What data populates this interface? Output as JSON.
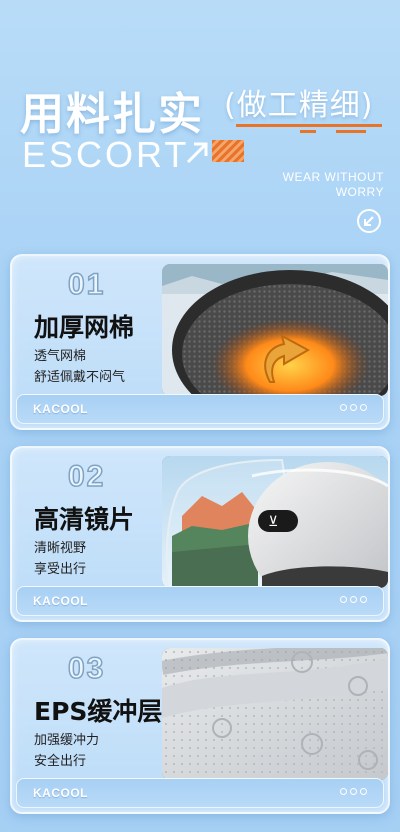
{
  "header": {
    "title_main": "用料扎实",
    "title_sub": "(做工精细)",
    "escort": "ESCORT",
    "tagline_line1": "WEAR WITHOUT",
    "tagline_line2": "WORRY",
    "accent_color": "#e8742a",
    "tagline_icon": "arrow-down-left-icon"
  },
  "cards": [
    {
      "number": "01",
      "title": "加厚网棉",
      "desc": "透气网棉\n舒适佩戴不闷气",
      "brand": "KACOOL"
    },
    {
      "number": "02",
      "title": "高清镜片",
      "desc": "清晰视野\n享受出行",
      "brand": "KACOOL"
    },
    {
      "number": "03",
      "title": "EPS缓冲层",
      "desc": "加强缓冲力\n安全出行",
      "brand": "KACOOL"
    }
  ]
}
